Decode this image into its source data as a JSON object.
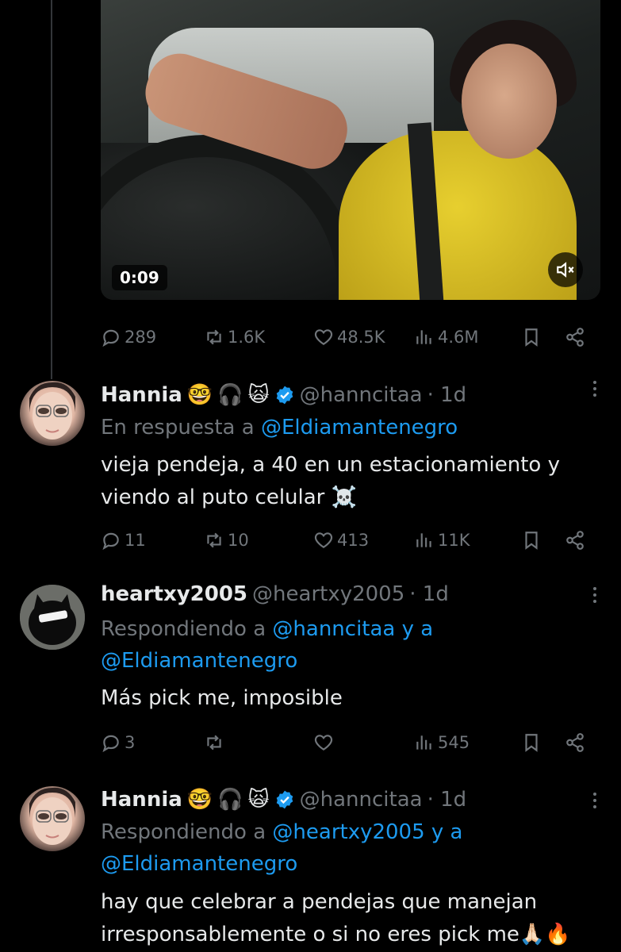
{
  "video": {
    "timestamp": "0:09",
    "mute_icon": "volume-muted-icon"
  },
  "main_actions": {
    "replies": "289",
    "reposts": "1.6K",
    "likes": "48.5K",
    "views": "4.6M"
  },
  "replies": [
    {
      "name": "Hannia",
      "handle": "@hanncitaa",
      "time": "· 1d",
      "reply_prefix": "En respuesta a",
      "reply_link": "@Eldiamantenegro",
      "text_lines": [
        "vieja pendeja, a 40 en un estacionamiento y",
        "viendo al puto celular ☠️"
      ],
      "actions": {
        "replies": "11",
        "reposts": "10",
        "likes": "413",
        "views": "11K"
      }
    },
    {
      "name": "heartxy2005",
      "handle": "@heartxy2005",
      "time": "· 1d",
      "reply_prefix": "Respondiendo a",
      "reply_link": "@hanncitaa y a",
      "reply_link2": "@Eldiamantenegro",
      "text_lines": [
        "Más pick me, imposible"
      ],
      "actions": {
        "replies": "3",
        "reposts": "",
        "likes": "",
        "views": "545"
      }
    },
    {
      "name": "Hannia",
      "handle": "@hanncitaa",
      "time": "· 1d",
      "reply_prefix": "Respondiendo a",
      "reply_link": "@heartxy2005 y a",
      "reply_link2": "@Eldiamantenegro",
      "text_lines": [
        "hay que celebrar a pendejas que manejan",
        "irresponsablemente o si no eres pick me🙏🏻🔥"
      ],
      "actions": {
        "replies": "",
        "reposts": "",
        "likes": "",
        "views": ""
      }
    }
  ],
  "colors": {
    "background": "#000000",
    "text": "#e7e9ea",
    "muted": "#71767b",
    "link": "#1d9bf0",
    "verified": "#1d9bf0"
  }
}
